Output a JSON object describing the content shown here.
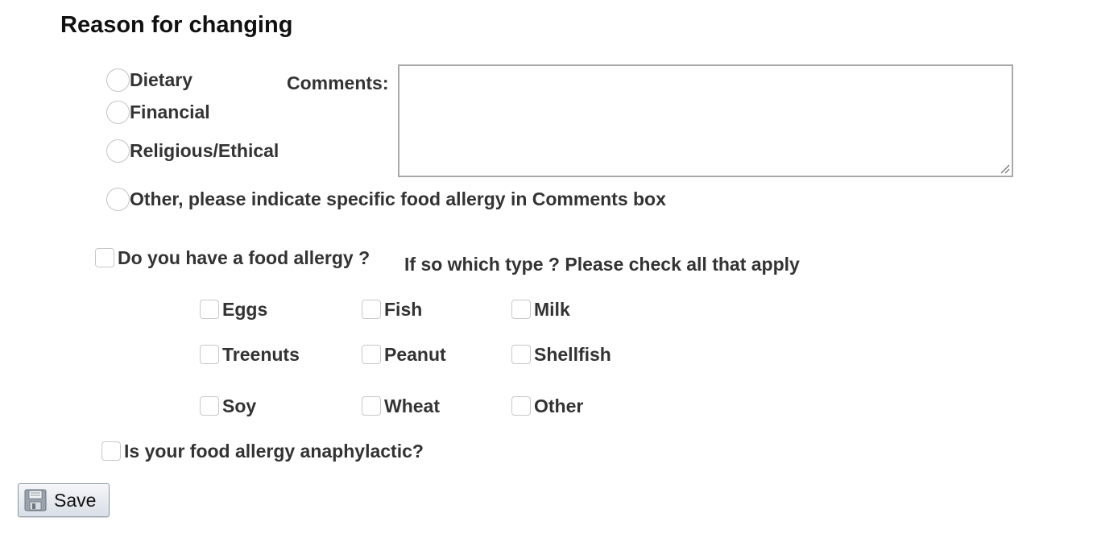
{
  "section": {
    "title": "Reason for changing"
  },
  "reasons": [
    {
      "label": "Dietary"
    },
    {
      "label": "Financial"
    },
    {
      "label": "Religious/Ethical"
    },
    {
      "label": "Other, please indicate specific food allergy in Comments box"
    }
  ],
  "comments": {
    "label": "Comments:",
    "value": ""
  },
  "allergy": {
    "question": "Do you have a food allergy ?",
    "type_prompt": "If so which type ? Please check all that apply",
    "types": [
      {
        "label": "Eggs"
      },
      {
        "label": "Fish"
      },
      {
        "label": "Milk"
      },
      {
        "label": "Treenuts"
      },
      {
        "label": "Peanut"
      },
      {
        "label": "Shellfish"
      },
      {
        "label": "Soy"
      },
      {
        "label": "Wheat"
      },
      {
        "label": "Other"
      }
    ],
    "anaphylactic": "Is your food allergy anaphylactic?"
  },
  "toolbar": {
    "save_label": "Save",
    "save_icon": "floppy-disk-icon"
  }
}
